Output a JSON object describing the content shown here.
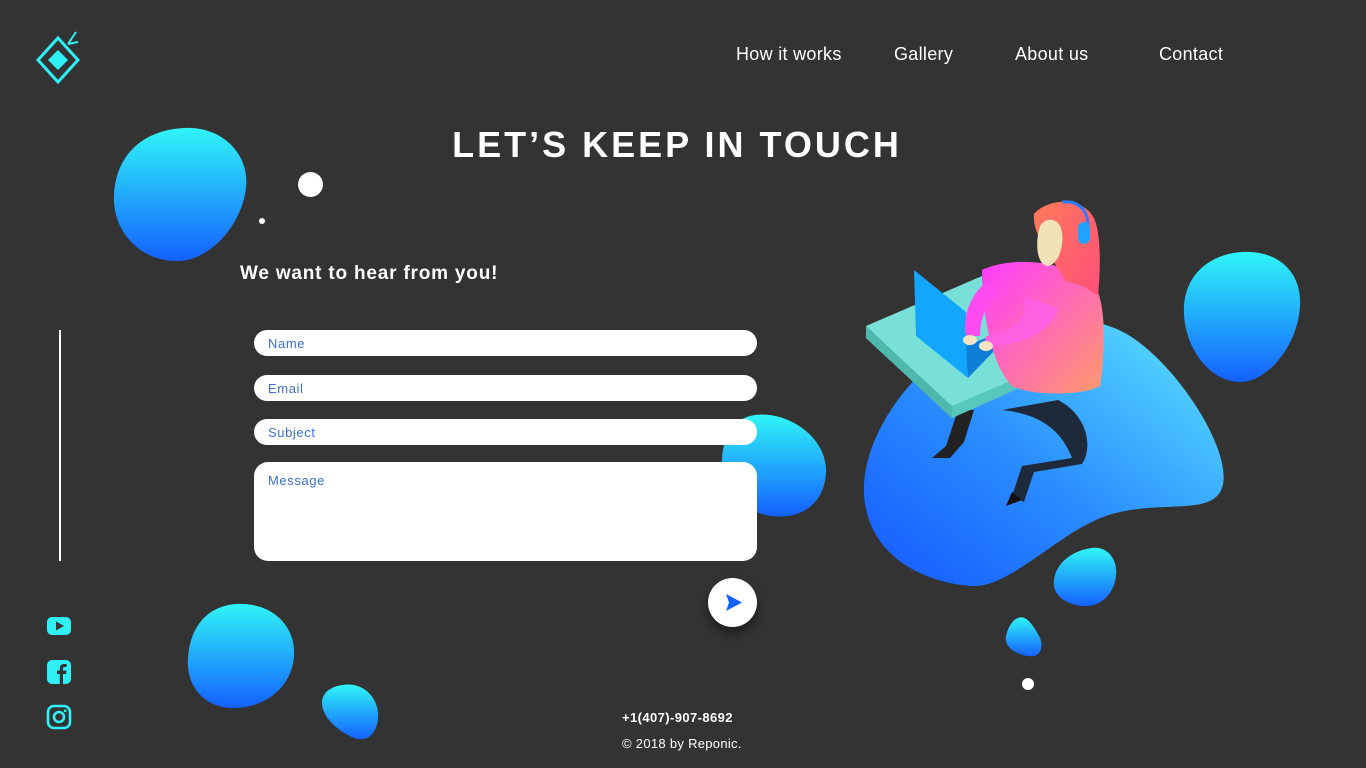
{
  "nav": {
    "items": [
      {
        "label": "How it works"
      },
      {
        "label": "Gallery"
      },
      {
        "label": "About us"
      },
      {
        "label": "Contact"
      }
    ]
  },
  "hero": {
    "title": "LET’S KEEP IN TOUCH",
    "subtitle": "We want to hear from you!"
  },
  "form": {
    "name_placeholder": "Name",
    "email_placeholder": "Email",
    "subject_placeholder": "Subject",
    "message_placeholder": "Message",
    "name_value": "",
    "email_value": "",
    "subject_value": "",
    "message_value": ""
  },
  "social": {
    "icons": [
      "youtube-icon",
      "facebook-icon",
      "instagram-icon"
    ]
  },
  "footer": {
    "phone": "+1(407)-907-8692",
    "copyright": "© 2018 by Reponic."
  },
  "colors": {
    "background": "#333333",
    "accent_cyan": "#2ff0f5",
    "accent_blue": "#1460ff",
    "placeholder_blue": "#3a6fd8"
  }
}
